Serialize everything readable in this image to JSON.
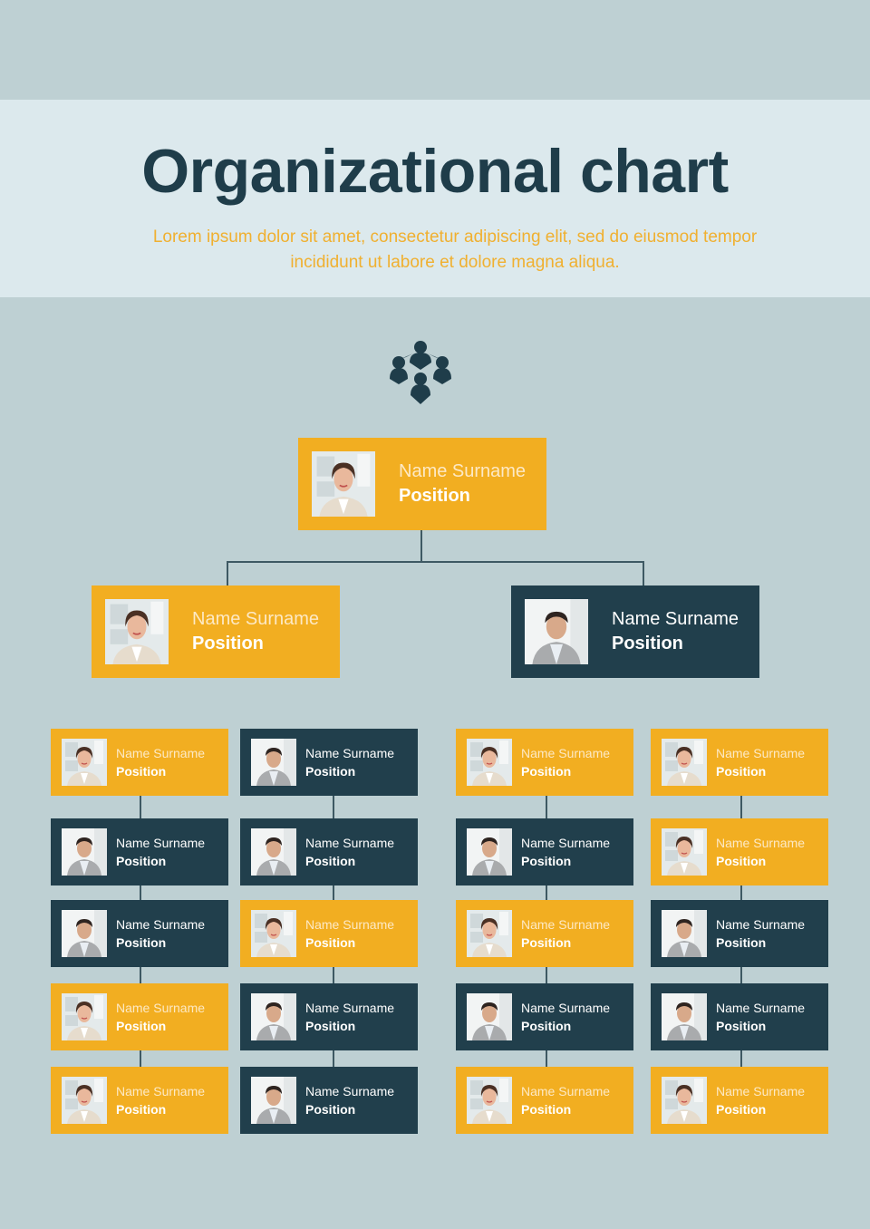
{
  "header": {
    "title": "Organizational chart",
    "subtitle_line1": "Lorem ipsum dolor sit amet, consectetur adipiscing elit, sed do eiusmod tempor",
    "subtitle_line2": "incididunt ut labore et dolore magna aliqua."
  },
  "logo": {
    "icon": "team-group-icon"
  },
  "colors": {
    "background": "#bed0d3",
    "header_band": "#dce9ed",
    "title": "#1f3d4a",
    "subtitle": "#f0b030",
    "yellow_card": "#f2ae21",
    "dark_card": "#213f4c",
    "connector": "#3e5963"
  },
  "top": {
    "name": "Name Surname",
    "position": "Position",
    "style": "yellow",
    "photo": "female"
  },
  "level2": [
    {
      "name": "Name Surname",
      "position": "Position",
      "style": "yellow",
      "photo": "female"
    },
    {
      "name": "Name Surname",
      "position": "Position",
      "style": "dark",
      "photo": "male"
    }
  ],
  "columns": [
    [
      {
        "name": "Name Surname",
        "position": "Position",
        "style": "yellow",
        "photo": "female"
      },
      {
        "name": "Name Surname",
        "position": "Position",
        "style": "dark",
        "photo": "male"
      },
      {
        "name": "Name Surname",
        "position": "Position",
        "style": "dark",
        "photo": "male"
      },
      {
        "name": "Name Surname",
        "position": "Position",
        "style": "yellow",
        "photo": "female"
      },
      {
        "name": "Name Surname",
        "position": "Position",
        "style": "yellow",
        "photo": "female"
      }
    ],
    [
      {
        "name": "Name Surname",
        "position": "Position",
        "style": "dark",
        "photo": "male"
      },
      {
        "name": "Name Surname",
        "position": "Position",
        "style": "dark",
        "photo": "male"
      },
      {
        "name": "Name Surname",
        "position": "Position",
        "style": "yellow",
        "photo": "female"
      },
      {
        "name": "Name Surname",
        "position": "Position",
        "style": "dark",
        "photo": "male"
      },
      {
        "name": "Name Surname",
        "position": "Position",
        "style": "dark",
        "photo": "male"
      }
    ],
    [
      {
        "name": "Name Surname",
        "position": "Position",
        "style": "yellow",
        "photo": "female"
      },
      {
        "name": "Name Surname",
        "position": "Position",
        "style": "dark",
        "photo": "male"
      },
      {
        "name": "Name Surname",
        "position": "Position",
        "style": "yellow",
        "photo": "female"
      },
      {
        "name": "Name Surname",
        "position": "Position",
        "style": "dark",
        "photo": "male"
      },
      {
        "name": "Name Surname",
        "position": "Position",
        "style": "yellow",
        "photo": "female"
      }
    ],
    [
      {
        "name": "Name Surname",
        "position": "Position",
        "style": "yellow",
        "photo": "female"
      },
      {
        "name": "Name Surname",
        "position": "Position",
        "style": "yellow",
        "photo": "female"
      },
      {
        "name": "Name Surname",
        "position": "Position",
        "style": "dark",
        "photo": "male"
      },
      {
        "name": "Name Surname",
        "position": "Position",
        "style": "dark",
        "photo": "male"
      },
      {
        "name": "Name Surname",
        "position": "Position",
        "style": "yellow",
        "photo": "female"
      }
    ]
  ]
}
